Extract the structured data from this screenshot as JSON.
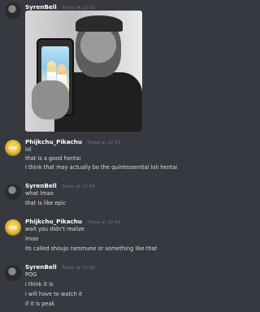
{
  "messages": [
    {
      "author": "SyrenBell",
      "timestamp": "Today at 12:51",
      "avatar_icon": "syrenbell-avatar",
      "lines": []
    },
    {
      "author": "Phijkchu_Pikachu",
      "timestamp": "Today at 12:51",
      "avatar_icon": "pikachu-avatar",
      "lines": [
        "lol",
        "that is a good hentai",
        "I think that may actually be the quintessential loli hentai"
      ]
    },
    {
      "author": "SyrenBell",
      "timestamp": "Today at 12:54",
      "avatar_icon": "syrenbell-avatar",
      "lines": [
        "what lmao",
        "that is like epic"
      ]
    },
    {
      "author": "Phijkchu_Pikachu",
      "timestamp": "Today at 12:54",
      "avatar_icon": "pikachu-avatar",
      "lines": [
        "wait you didn't realize",
        "lmao",
        "its called shoujo rammune or something like that"
      ]
    },
    {
      "author": "SyrenBell",
      "timestamp": "Today at 13:00",
      "avatar_icon": "syrenbell-avatar",
      "lines": [
        "POG",
        "i think it is",
        "i will have to watch it",
        "if it is peak"
      ]
    }
  ]
}
